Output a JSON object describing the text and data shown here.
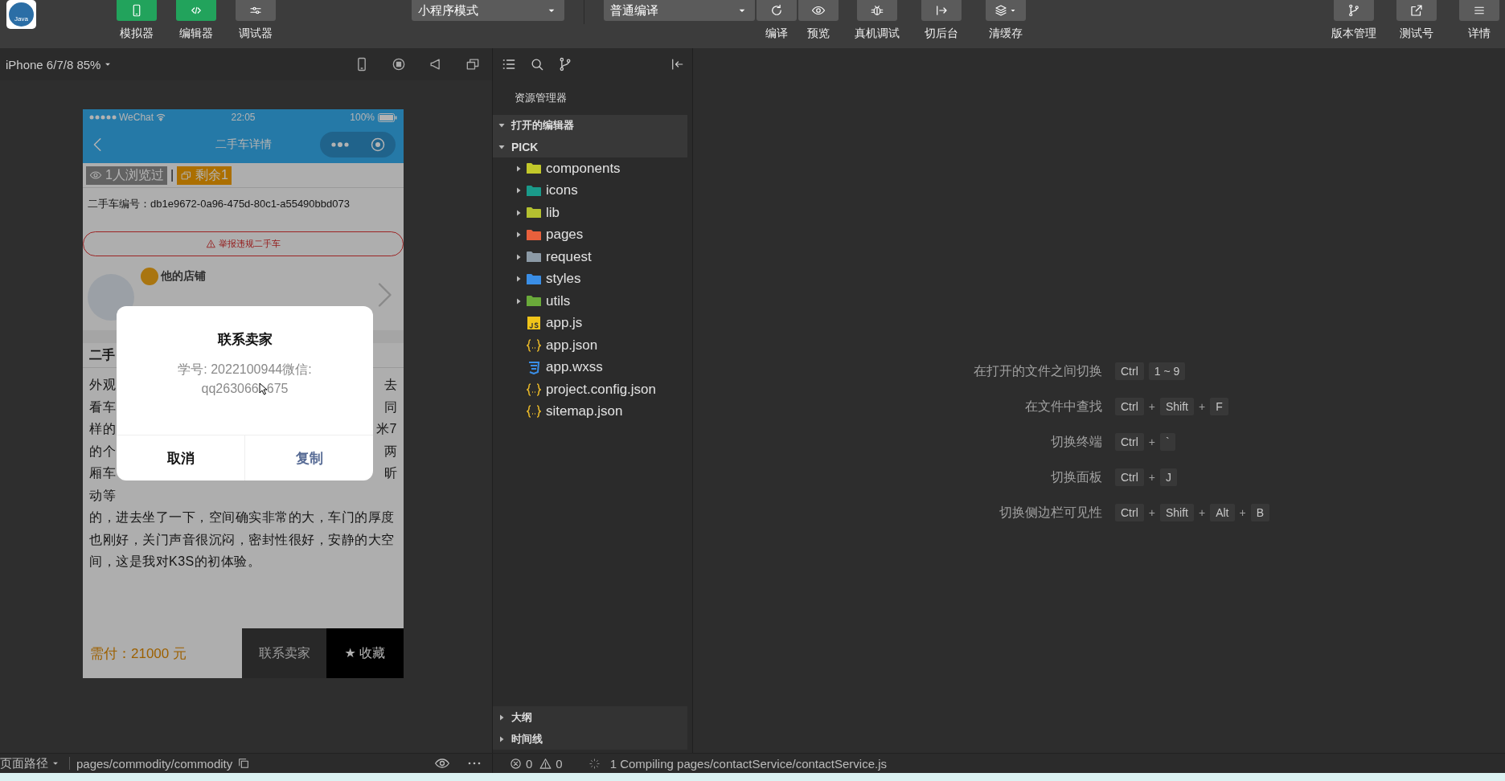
{
  "toolbar": {
    "logo_text": "Java",
    "view_toggles": [
      {
        "label": "模拟器",
        "selected": true
      },
      {
        "label": "编辑器",
        "selected": true
      },
      {
        "label": "调试器",
        "selected": false
      }
    ],
    "mode_dropdown": "小程序模式",
    "compile_dropdown": "普通编译",
    "actions": [
      "编译",
      "预览",
      "真机调试",
      "切后台",
      "清缓存"
    ],
    "right_actions": [
      "版本管理",
      "测试号",
      "详情"
    ]
  },
  "simulator": {
    "device": "iPhone 6/7/8 85%",
    "phone": {
      "carrier": "WeChat",
      "time": "22:05",
      "battery": "100%",
      "nav_title": "二手车详情",
      "views": "1人浏览过",
      "separator": "|",
      "stock": "剩余1",
      "code": "二手车编号：db1e9672-0a96-475d-80c1-a55490bbd073",
      "report": "举报违规二手车",
      "shop": "他的店铺",
      "heading": "二手",
      "lines": [
        {
          "left": "外观",
          "right": "去"
        },
        {
          "left": "看车",
          "right": "同"
        },
        {
          "left": "样的",
          "right": "米7"
        },
        {
          "left": "的个",
          "right": "两"
        },
        {
          "left": "厢车",
          "right": "昕"
        },
        {
          "left": "动等"
        },
        {
          "left": "的，进去坐了一下，空间确实非常的大，车门的厚度"
        },
        {
          "left": "也刚好，关门声音很沉闷，密封性很好，安静的大空"
        },
        {
          "left": "间，这是我对K3S的初体验。"
        }
      ],
      "price": "需付：21000 元",
      "contact": "联系卖家",
      "favorite": "★ 收藏",
      "dialog": {
        "title": "联系卖家",
        "message": "学号: 2022100944微信:",
        "account_start": "qq263066",
        "account_end": "675",
        "cancel": "取消",
        "confirm": "复制"
      }
    }
  },
  "explorer": {
    "title": "资源管理器",
    "sections": [
      {
        "label": "打开的编辑器",
        "expanded": true
      },
      {
        "label": "PICK",
        "expanded": true,
        "children": [
          {
            "name": "components",
            "kind": "folder",
            "expanded": false,
            "color": "#c2c82a"
          },
          {
            "name": "icons",
            "kind": "folder",
            "expanded": false,
            "color": "#1a9a8a"
          },
          {
            "name": "lib",
            "kind": "folder",
            "expanded": false,
            "color": "#b4c030"
          },
          {
            "name": "pages",
            "kind": "folder",
            "expanded": false,
            "color": "#e8603c"
          },
          {
            "name": "request",
            "kind": "folder",
            "expanded": false,
            "color": "#8c9aa6"
          },
          {
            "name": "styles",
            "kind": "folder",
            "expanded": false,
            "color": "#3a8ee6"
          },
          {
            "name": "utils",
            "kind": "folder",
            "expanded": false,
            "color": "#6aaa3a"
          },
          {
            "name": "app.js",
            "kind": "js"
          },
          {
            "name": "app.json",
            "kind": "json"
          },
          {
            "name": "app.wxss",
            "kind": "css"
          },
          {
            "name": "project.config.json",
            "kind": "json"
          },
          {
            "name": "sitemap.json",
            "kind": "json"
          }
        ]
      }
    ],
    "bottom_sections": [
      {
        "label": "大纲",
        "expanded": false
      },
      {
        "label": "时间线",
        "expanded": false
      }
    ]
  },
  "shortcuts": [
    {
      "label": "在打开的文件之间切换",
      "keys": [
        {
          "text": "Ctrl",
          "kind": "key"
        },
        {
          "text": "1 ~ 9",
          "kind": "key"
        }
      ]
    },
    {
      "label": "在文件中查找",
      "keys": [
        {
          "text": "Ctrl",
          "kind": "key"
        },
        {
          "text": "+",
          "kind": "plus"
        },
        {
          "text": "Shift",
          "kind": "key"
        },
        {
          "text": "+",
          "kind": "plus"
        },
        {
          "text": "F",
          "kind": "key"
        }
      ]
    },
    {
      "label": "切换终端",
      "keys": [
        {
          "text": "Ctrl",
          "kind": "key"
        },
        {
          "text": "+",
          "kind": "plus"
        },
        {
          "text": "`",
          "kind": "key"
        }
      ]
    },
    {
      "label": "切换面板",
      "keys": [
        {
          "text": "Ctrl",
          "kind": "key"
        },
        {
          "text": "+",
          "kind": "plus"
        },
        {
          "text": "J",
          "kind": "key"
        }
      ]
    },
    {
      "label": "切换侧边栏可见性",
      "keys": [
        {
          "text": "Ctrl",
          "kind": "key"
        },
        {
          "text": "+",
          "kind": "plus"
        },
        {
          "text": "Shift",
          "kind": "key"
        },
        {
          "text": "+",
          "kind": "plus"
        },
        {
          "text": "Alt",
          "kind": "key"
        },
        {
          "text": "+",
          "kind": "plus"
        },
        {
          "text": "B",
          "kind": "key"
        }
      ]
    }
  ],
  "status_bar": {
    "route_label": "页面路径",
    "route": "pages/commodity/commodity",
    "errors": "0",
    "warnings": "0",
    "message": "1 Compiling pages/contactService/contactService.js"
  }
}
